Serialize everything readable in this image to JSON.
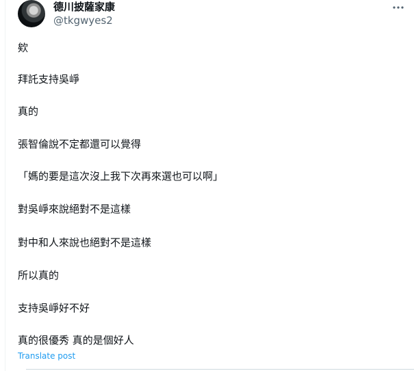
{
  "author": {
    "display_name": "德川披薩家康",
    "handle": "@tkgwyes2"
  },
  "post": {
    "lines": [
      "欸",
      "拜託支持吳崢",
      "真的",
      "張智倫說不定都還可以覺得",
      "「媽的要是這次沒上我下次再來選也可以啊」",
      "對吳崢來說絕對不是這樣",
      "對中和人來說也絕對不是這樣",
      "所以真的",
      "支持吳崢好不好",
      "真的很優秀 真的是個好人"
    ],
    "translate_label": "Translate post"
  },
  "icons": {
    "more": "more-horizontal-icon",
    "avatar": "profile-photo"
  },
  "colors": {
    "text_primary": "#0f1419",
    "text_secondary": "#536471",
    "link": "#1d9bf0",
    "divider": "#cfd9de"
  }
}
